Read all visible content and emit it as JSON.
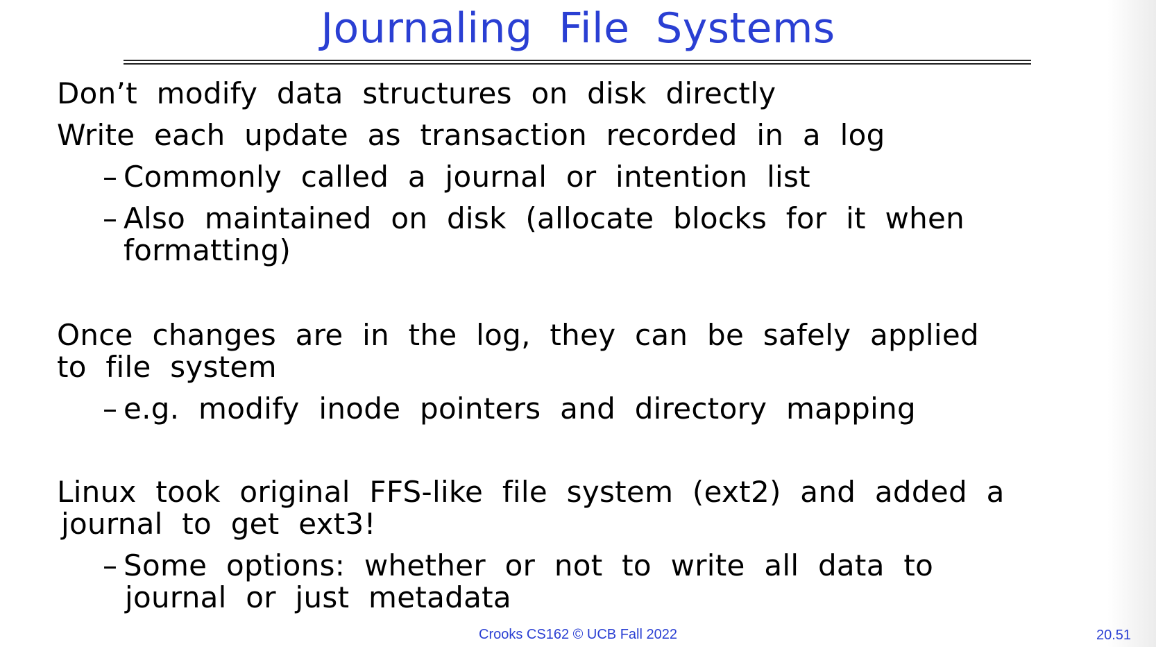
{
  "slide": {
    "title": "Journaling File Systems",
    "bullets": [
      "Don’t modify data structures on disk directly",
      "Write each update as transaction recorded in a log",
      "Commonly called a journal or intention list",
      "Also maintained on disk (allocate blocks for it when",
      "formatting)",
      "Once changes are in the log, they can be safely applied",
      "to file system",
      "e.g. modify inode pointers and directory mapping",
      "Linux took original FFS-like file system (ext2) and added a",
      "journal to get ext3!",
      "Some options: whether or not to write all data to",
      "journal or just metadata"
    ],
    "dash": "–",
    "footer": "Crooks CS162 © UCB Fall 2022",
    "page_number": "20.51"
  },
  "colors": {
    "title": "#2a3fd3",
    "body_text": "#000000",
    "footer": "#2a3fd3"
  }
}
